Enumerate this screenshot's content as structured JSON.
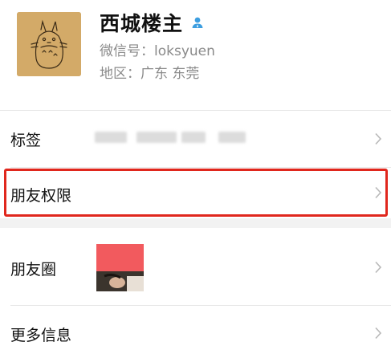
{
  "profile": {
    "name": "西城楼主",
    "wechat_id_label": "微信号：",
    "wechat_id": "loksyuen",
    "region_label": "地区：",
    "region": "广东 东莞",
    "gender_icon": "person-icon",
    "avatar_icon": "totoro-sketch"
  },
  "rows": {
    "tags": {
      "label": "标签"
    },
    "friend_permissions": {
      "label": "朋友权限",
      "highlighted": true
    },
    "moments": {
      "label": "朋友圈"
    },
    "more_info": {
      "label": "更多信息"
    }
  },
  "colors": {
    "highlight": "#e0271d",
    "avatar_bg": "#d3aa68",
    "icon_blue": "#3d9ee0",
    "secondary_text": "#8a8a8a"
  },
  "icons": {
    "chevron": "chevron-right-icon"
  }
}
